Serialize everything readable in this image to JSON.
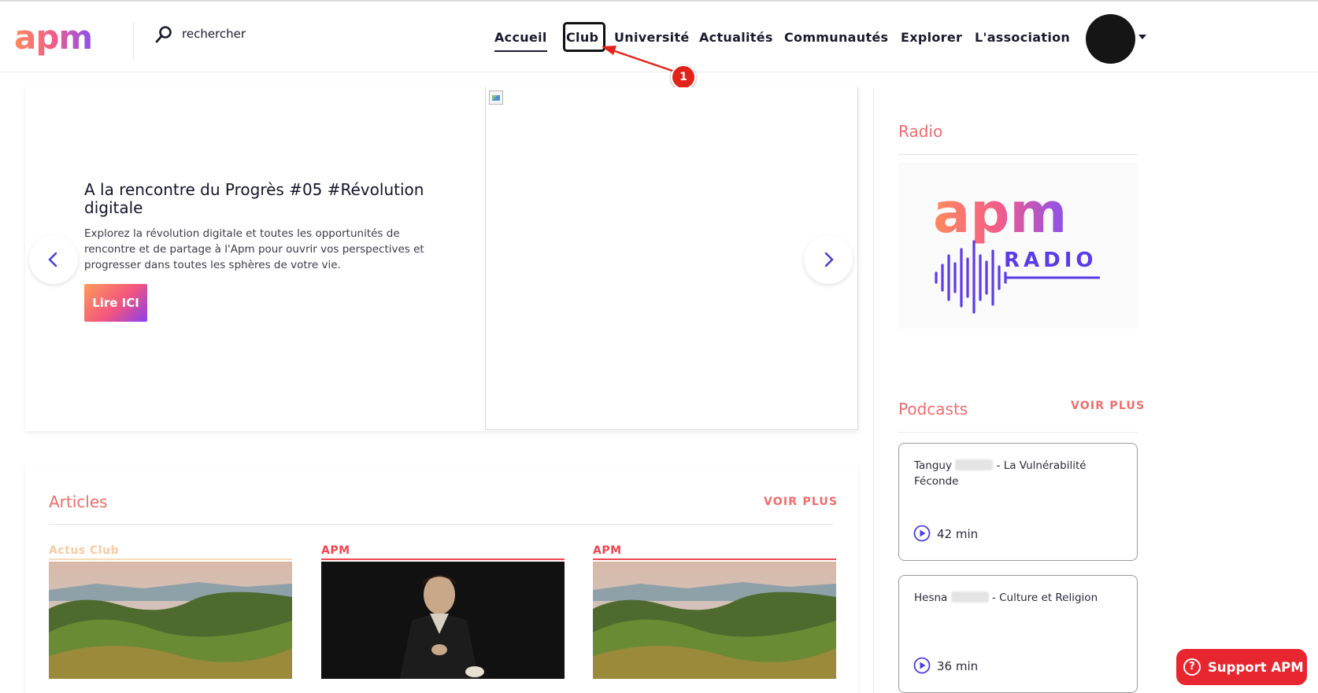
{
  "header": {
    "logo_text": "apm",
    "search_placeholder": "rechercher",
    "nav": [
      {
        "label": "Accueil"
      },
      {
        "label": "Club"
      },
      {
        "label": "Université"
      },
      {
        "label": "Actualités"
      },
      {
        "label": "Communautés"
      },
      {
        "label": "Explorer"
      },
      {
        "label": "L'association"
      }
    ]
  },
  "annotation": {
    "badge": "1",
    "color": "#e2231a"
  },
  "hero": {
    "title": "A la rencontre du Progrès #05 #Révolution digitale",
    "description": "Explorez la révolution digitale et toutes les opportunités de rencontre et de partage à l'Apm pour ouvrir vos perspectives et progresser dans toutes les sphères de votre vie.",
    "button_label": "Lire ICI"
  },
  "articles": {
    "title": "Articles",
    "voir_plus": "VOIR PLUS",
    "items": [
      {
        "tag": "Actus Club",
        "tag_color": "#f9c9a2"
      },
      {
        "tag": "APM",
        "tag_color": "#f0454f"
      },
      {
        "tag": "APM",
        "tag_color": "#f0454f"
      }
    ]
  },
  "radio": {
    "title": "Radio",
    "logo_text": "apm",
    "logo_sub": "RADIO"
  },
  "podcasts": {
    "title": "Podcasts",
    "voir_plus": "VOIR PLUS",
    "items": [
      {
        "name": "Tanguy",
        "rest": "- La Vulnérabilité Féconde",
        "duration": "42 min"
      },
      {
        "name": "Hesna",
        "rest": "- Culture et Religion",
        "duration": "36 min"
      }
    ]
  },
  "support": {
    "label": "Support APM"
  },
  "colors": {
    "accent": "#f26b6b",
    "brand_gradient": [
      "#ff8a5c",
      "#f25c8a",
      "#8a4ff0"
    ],
    "support": "#e8262f"
  }
}
